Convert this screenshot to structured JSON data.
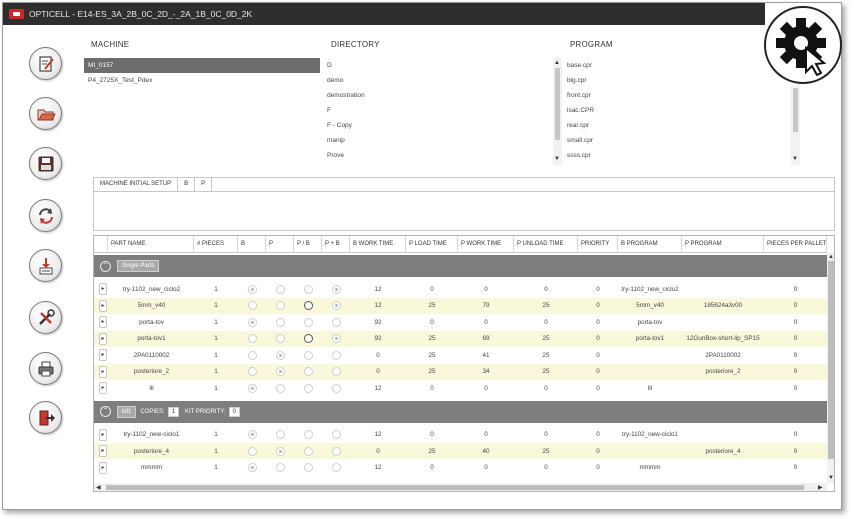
{
  "window": {
    "title": "OPTICELL - E14-ES_3A_2B_0C_2D_-_2A_1B_0C_0D_2K"
  },
  "sidebar": {
    "buttons": [
      {
        "name": "edit-button",
        "icon": "edit-icon"
      },
      {
        "name": "open-button",
        "icon": "folder-open-icon"
      },
      {
        "name": "save-button",
        "icon": "save-icon"
      },
      {
        "name": "refresh-button",
        "icon": "refresh-icon"
      },
      {
        "name": "download-button",
        "icon": "download-icon"
      },
      {
        "name": "tools-button",
        "icon": "tools-icon"
      },
      {
        "name": "print-button",
        "icon": "print-icon"
      },
      {
        "name": "exit-button",
        "icon": "exit-icon"
      }
    ]
  },
  "settings": {
    "icon": "gear-icon"
  },
  "machine": {
    "label": "MACHINE",
    "items": [
      "MI_0157",
      "P4_2725X_Test_Pdex"
    ],
    "selected_index": 0
  },
  "directory": {
    "label": "DIRECTORY",
    "items": [
      "D",
      "demo",
      "demostration",
      "F",
      "F - Copy",
      "manip",
      "Prove"
    ]
  },
  "program": {
    "label": "PROGRAM",
    "items": [
      "base.cpr",
      "big.cpr",
      "front.cpr",
      "lsac.CPR",
      "rear.cpr",
      "small.cpr",
      "ssss.cpr"
    ]
  },
  "setup": {
    "tabs": [
      "MACHINE INITIAL SETUP",
      "B",
      "P"
    ]
  },
  "grid": {
    "columns": [
      "PART NAME",
      "# PIECES",
      "B",
      "P",
      "P / B",
      "P + B",
      "B WORK TIME",
      "P LOAD TIME",
      "P WORK TIME",
      "P UNLOAD TIME",
      "PRIORITY",
      "B PROGRAM",
      "P PROGRAM",
      "PIECES PER PALLET"
    ],
    "group1": {
      "tag": "Single Parts",
      "collapse_symbol": "⌃",
      "rows": [
        {
          "name": "try-1102_new_ciclo2",
          "pieces": "1",
          "b": "checked",
          "p": "empty",
          "pb": "empty",
          "ppb": "checked",
          "bwork": "12",
          "pload": "0",
          "pwork": "0",
          "punload": "0",
          "priority": "0",
          "bprog": "try-1102_new_ciclo2",
          "pprog": "",
          "ppp": "0",
          "style": "white"
        },
        {
          "name": "5mm_v40",
          "pieces": "1",
          "b": "empty",
          "p": "empty",
          "pb": "dark",
          "ppb": "checked",
          "bwork": "12",
          "pload": "25",
          "pwork": "79",
          "punload": "25",
          "priority": "0",
          "bprog": "5mm_v40",
          "pprog": "185624a3v00",
          "ppp": "0",
          "style": "yellow"
        },
        {
          "name": "porta-tov",
          "pieces": "1",
          "b": "checked",
          "p": "empty",
          "pb": "empty",
          "ppb": "empty",
          "bwork": "92",
          "pload": "0",
          "pwork": "0",
          "punload": "0",
          "priority": "0",
          "bprog": "porta-tov",
          "pprog": "",
          "ppp": "0",
          "style": "white"
        },
        {
          "name": "porta-tov1",
          "pieces": "1",
          "b": "empty",
          "p": "empty",
          "pb": "dark",
          "ppb": "checked",
          "bwork": "92",
          "pload": "25",
          "pwork": "69",
          "punload": "25",
          "priority": "0",
          "bprog": "porta-tov1",
          "pprog": "12GunBox-short-lip_SP15",
          "ppp": "0",
          "style": "yellow"
        },
        {
          "name": "2PA0110002",
          "pieces": "1",
          "b": "empty",
          "p": "checked",
          "pb": "empty",
          "ppb": "empty",
          "bwork": "0",
          "pload": "25",
          "pwork": "41",
          "punload": "25",
          "priority": "0",
          "bprog": "",
          "pprog": "2PA0110002",
          "ppp": "0",
          "style": "white"
        },
        {
          "name": "posteriore_2",
          "pieces": "1",
          "b": "empty",
          "p": "checked",
          "pb": "empty",
          "ppb": "empty",
          "bwork": "0",
          "pload": "25",
          "pwork": "34",
          "punload": "25",
          "priority": "0",
          "bprog": "",
          "pprog": "posteriore_2",
          "ppp": "0",
          "style": "yellow"
        },
        {
          "name": "lll",
          "pieces": "1",
          "b": "checked",
          "p": "empty",
          "pb": "empty",
          "ppb": "empty",
          "bwork": "12",
          "pload": "0",
          "pwork": "0",
          "punload": "0",
          "priority": "0",
          "bprog": "lll",
          "pprog": "",
          "ppp": "0",
          "style": "white"
        }
      ]
    },
    "group2": {
      "tag": "kit1",
      "copies_label": "COPIES:",
      "copies_value": "1",
      "priority_label": "KIT PRIORITY:",
      "priority_value": "0",
      "collapse_symbol": "⌃",
      "rows": [
        {
          "name": "try-1102_new-ciclo1",
          "pieces": "1",
          "b": "checked",
          "p": "empty",
          "pb": "empty",
          "ppb": "empty",
          "bwork": "12",
          "pload": "0",
          "pwork": "0",
          "punload": "0",
          "priority": "0",
          "bprog": "try-1102_new-ciclo1",
          "pprog": "",
          "ppp": "0",
          "style": "white"
        },
        {
          "name": "posteriore_4",
          "pieces": "1",
          "b": "empty",
          "p": "checked",
          "pb": "empty",
          "ppb": "empty",
          "bwork": "0",
          "pload": "25",
          "pwork": "40",
          "punload": "25",
          "priority": "0",
          "bprog": "",
          "pprog": "posteriore_4",
          "ppp": "0",
          "style": "yellow"
        },
        {
          "name": "mmmm",
          "pieces": "1",
          "b": "checked",
          "p": "empty",
          "pb": "empty",
          "ppb": "empty",
          "bwork": "12",
          "pload": "0",
          "pwork": "0",
          "punload": "0",
          "priority": "0",
          "bprog": "mmmm",
          "pprog": "",
          "ppp": "0",
          "style": "white"
        }
      ]
    },
    "row_marker": "▸"
  }
}
